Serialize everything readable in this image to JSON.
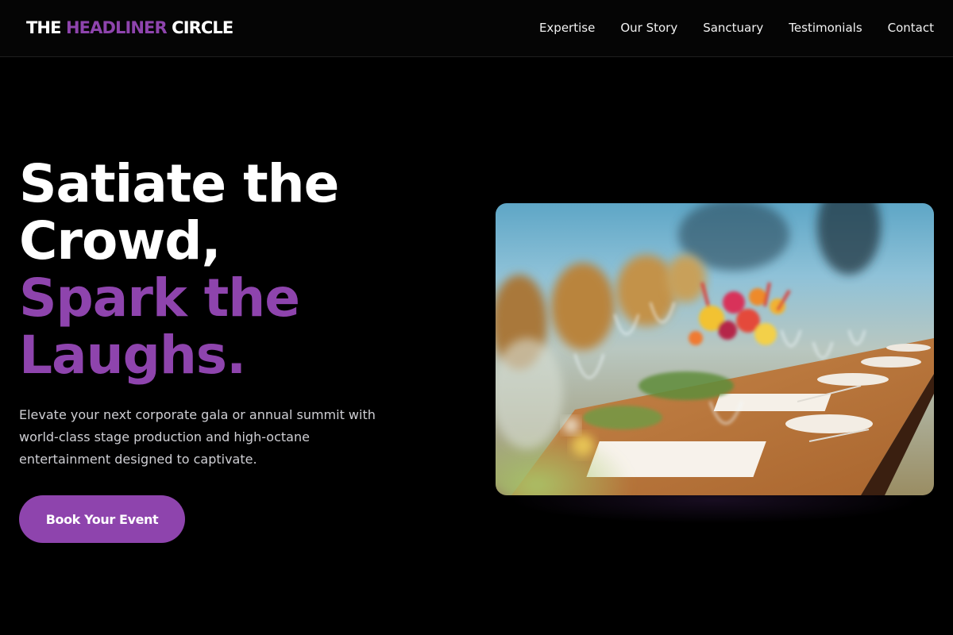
{
  "brand": {
    "part1": "THE ",
    "part2": "HEADLINER",
    "part3": " CIRCLE",
    "accent_color": "#8e44ad"
  },
  "nav": {
    "items": [
      {
        "label": "Expertise"
      },
      {
        "label": "Our Story"
      },
      {
        "label": "Sanctuary"
      },
      {
        "label": "Testimonials"
      },
      {
        "label": "Contact"
      }
    ]
  },
  "hero": {
    "headline_lines": [
      "Satiate the",
      "Crowd,"
    ],
    "headline_accent_lines": [
      "Spark the",
      "Laughs."
    ],
    "subtext_lines": [
      "Elevate your next corporate gala or annual summit with",
      "world-class stage production and high-octane",
      "entertainment designed to captivate."
    ],
    "cta_label": "Book Your Event",
    "image_icon": "banquet-table-photo"
  }
}
